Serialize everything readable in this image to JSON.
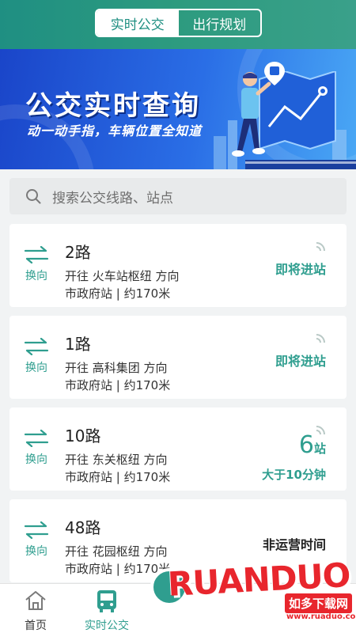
{
  "header": {
    "tabs": [
      {
        "label": "实时公交",
        "active": true
      },
      {
        "label": "出行规划",
        "active": false
      }
    ]
  },
  "banner": {
    "title": "公交实时查询",
    "subtitle": "动一动手指，车辆位置全知道"
  },
  "search": {
    "placeholder": "搜索公交线路、站点"
  },
  "routes": [
    {
      "route": "2路",
      "direction": "开往 火车站枢纽 方向",
      "stop": "市政府站 | 约170米",
      "swap_label": "换向",
      "status": "即将进站"
    },
    {
      "route": "1路",
      "direction": "开往 高科集团 方向",
      "stop": "市政府站 | 约170米",
      "swap_label": "换向",
      "status": "即将进站"
    },
    {
      "route": "10路",
      "direction": "开往 东关枢纽 方向",
      "stop": "市政府站 | 约170米",
      "swap_label": "换向",
      "stops_away": "6",
      "stops_unit": "站",
      "wait": "大于10分钟"
    },
    {
      "route": "48路",
      "direction": "开往 花园枢纽 方向",
      "stop": "市政府站 | 约170米",
      "swap_label": "换向",
      "status": "非运营时间"
    }
  ],
  "tabbar": {
    "items": [
      {
        "label": "首页",
        "icon": "home-icon",
        "active": false
      },
      {
        "label": "实时公交",
        "icon": "bus-icon",
        "active": true
      }
    ]
  },
  "watermark": {
    "text": "RUANDUO",
    "badge": "如多下载网",
    "url": "www.ruaduo.com"
  },
  "colors": {
    "accent": "#2f9e8f",
    "header": "#1f8f82",
    "banner": "#1a45c9"
  }
}
